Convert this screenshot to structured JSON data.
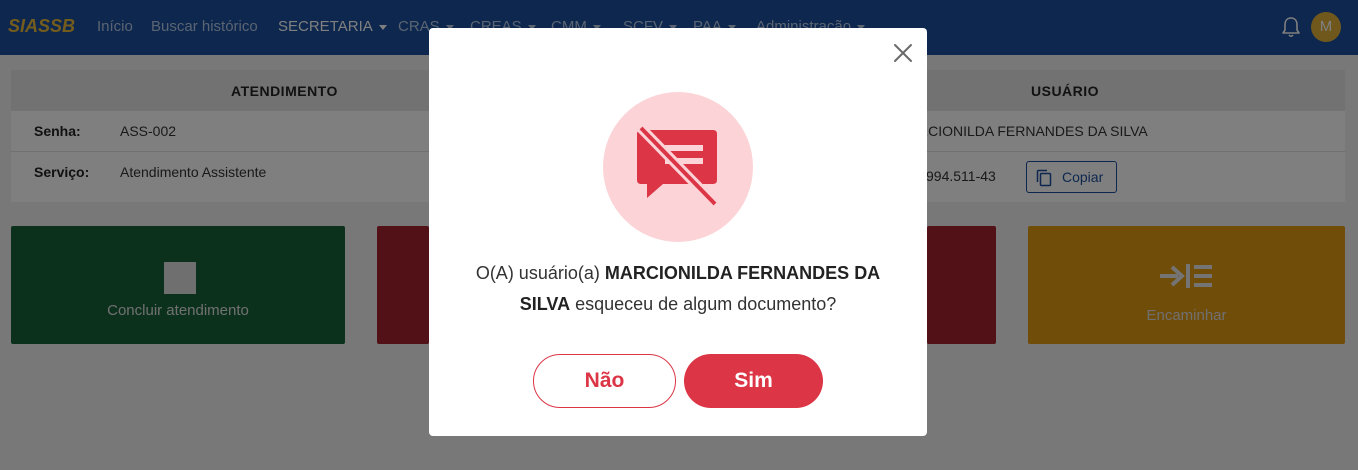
{
  "navbar": {
    "brand": "SIASSB",
    "items": [
      {
        "label": "Início"
      },
      {
        "label": "Buscar histórico"
      },
      {
        "label": "SECRETARIA"
      },
      {
        "label": "CRAS"
      },
      {
        "label": "CREAS"
      },
      {
        "label": "CMM"
      },
      {
        "label": "SCFV"
      },
      {
        "label": "PAA"
      },
      {
        "label": "Administração"
      }
    ],
    "avatar_initial": "M",
    "bell_icon": "bell-icon"
  },
  "info": {
    "atendimento_header": "ATENDIMENTO",
    "usuario_header": "USUÁRIO",
    "senha_label": "Senha:",
    "senha_value": "ASS-002",
    "servico_label": "Serviço:",
    "servico_value": "Atendimento Assistente",
    "usuario_name_partial": "RCIONILDA FERNANDES DA SILVA",
    "usuario_doc_partial": "994.511-43",
    "copy_label": "Copiar"
  },
  "actions": [
    {
      "label": "Concluir atendimento",
      "color": "#16623a"
    },
    {
      "label": "",
      "color": "#a3222f"
    },
    {
      "label": "",
      "color": "#a3222f"
    },
    {
      "label": "Encaminhar",
      "color": "#e09a10"
    }
  ],
  "modal": {
    "text_prefix": "O(A) usuário(a) ",
    "user_name": "MARCIONILDA FERNANDES DA SILVA",
    "text_suffix": " esqueceu de algum documento?",
    "no_label": "Não",
    "yes_label": "Sim",
    "icon": "message-off-icon",
    "accent_color": "#dc3545"
  }
}
